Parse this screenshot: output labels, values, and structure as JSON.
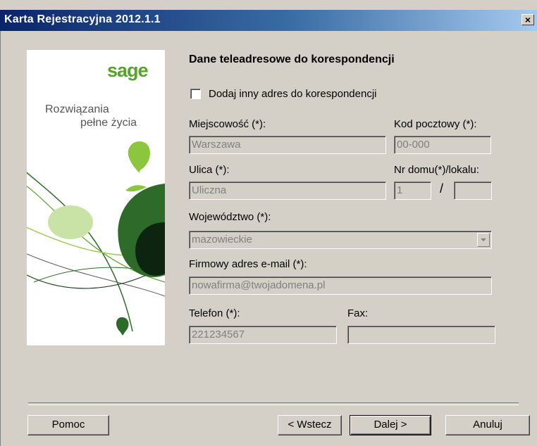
{
  "window": {
    "title": "Karta Rejestracyjna 2012.1.1",
    "close_label": "×"
  },
  "banner": {
    "logo": "sage",
    "tagline_line1": "Rozwiązania",
    "tagline_line2": "pełne życia",
    "colors": {
      "logo": "#5aa02c",
      "dark_green": "#2e6b2a",
      "light_green": "#8cc63f",
      "pale_green": "#c9e3a6",
      "very_dark": "#0c2410"
    }
  },
  "form": {
    "section_title": "Dane teleadresowe do korespondencji",
    "alt_address_checkbox": {
      "label": "Dodaj inny adres do korespondencji",
      "checked": false
    },
    "city": {
      "label": "Miejscowość (*):",
      "value": "Warszawa"
    },
    "postal_code": {
      "label": "Kod pocztowy (*):",
      "value": "00-000"
    },
    "street": {
      "label": "Ulica (*):",
      "value": "Uliczna"
    },
    "house_number": {
      "label": "Nr domu(*)/lokalu:",
      "value": "1",
      "separator": "/"
    },
    "apartment_number": {
      "value": ""
    },
    "province": {
      "label": "Województwo (*):",
      "value": "mazowieckie"
    },
    "email": {
      "label": "Firmowy adres e-mail (*):",
      "value": "nowafirma@twojadomena.pl"
    },
    "phone": {
      "label": "Telefon (*):",
      "value": "221234567"
    },
    "fax": {
      "label": "Fax:",
      "value": ""
    }
  },
  "buttons": {
    "help": "Pomoc",
    "back": "< Wstecz",
    "next": "Dalej >",
    "cancel": "Anuluj"
  },
  "colors": {
    "dialog_bg": "#d4d0c8",
    "title_bar_start": "#0a246a",
    "title_bar_end": "#a6caf0",
    "disabled_text": "#808080"
  }
}
